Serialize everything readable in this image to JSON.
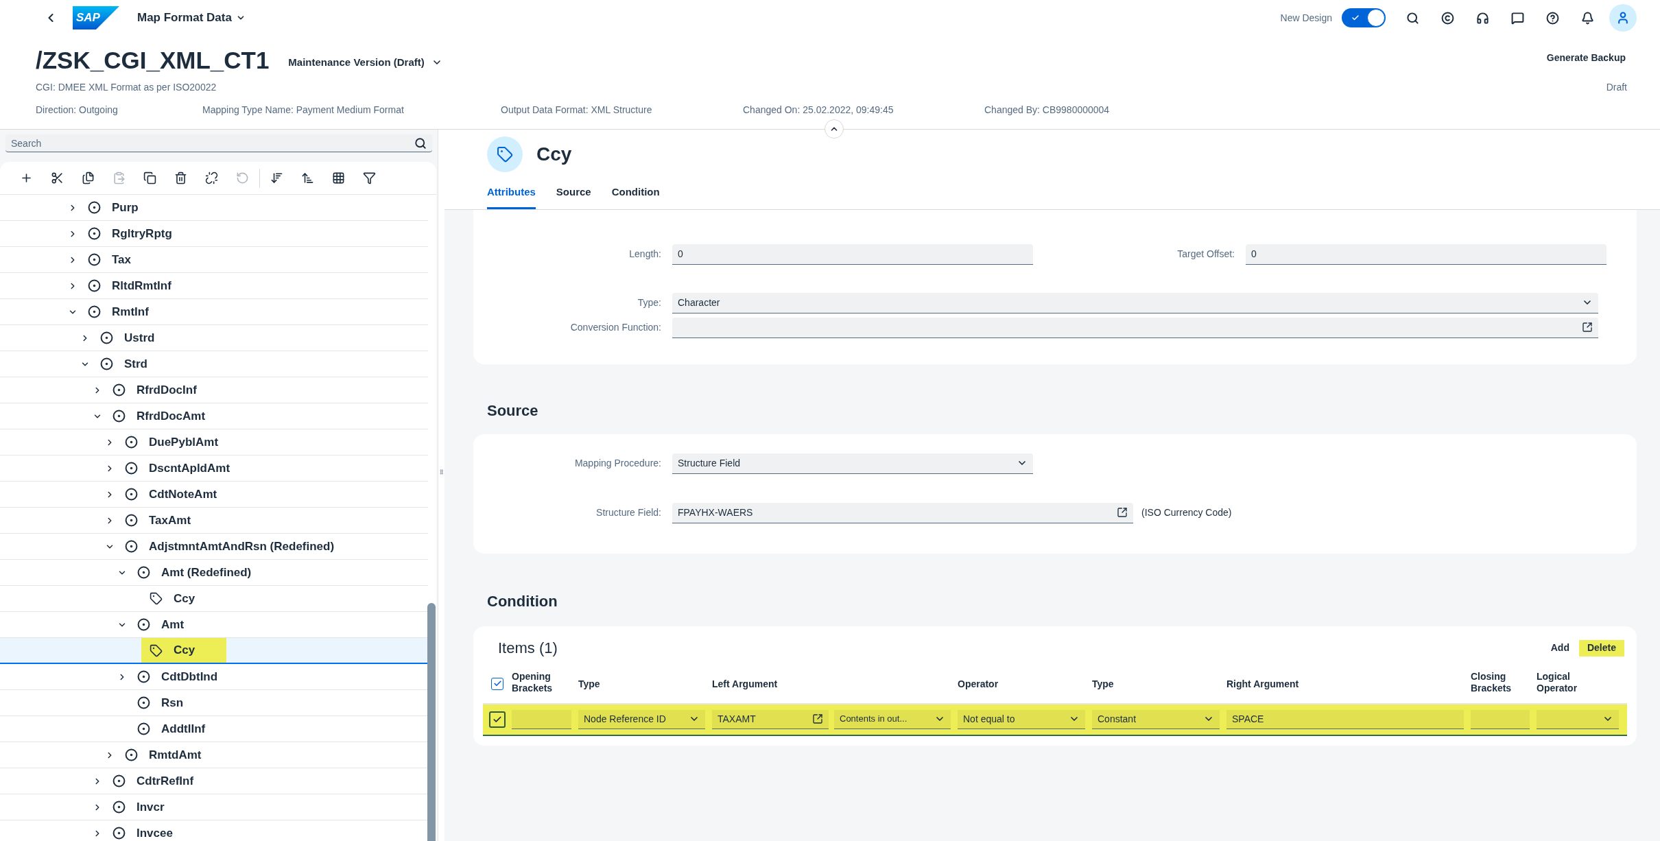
{
  "shell": {
    "logo": "SAP",
    "app_title": "Map Format Data",
    "new_design": {
      "label": "New Design",
      "on": true
    }
  },
  "header": {
    "title": "/ZSK_CGI_XML_CT1",
    "version": "Maintenance Version (Draft)",
    "subtitle": "CGI: DMEE XML Format as per ISO20022",
    "action": "Generate Backup",
    "status": "Draft",
    "attributes": [
      "Direction: Outgoing",
      "Mapping Type Name: Payment Medium Format",
      "Output Data Format: XML Structure",
      "Changed On: 25.02.2022, 09:49:45",
      "Changed By: CB9980000004"
    ]
  },
  "tree": {
    "search": {
      "placeholder": "Search"
    },
    "toolbar": [
      {
        "disabled": false
      },
      {
        "disabled": false
      },
      {
        "disabled": false
      },
      {
        "disabled": true
      },
      {
        "disabled": false
      },
      {
        "disabled": false
      },
      {
        "disabled": false
      },
      {
        "disabled": true
      },
      {
        "disabled": false
      },
      {
        "disabled": false
      },
      {
        "disabled": false
      },
      {
        "disabled": false
      }
    ],
    "nodes": [
      {
        "label": "Purp",
        "kind": "element",
        "expandable": true,
        "expanded": false,
        "selected": false,
        "highlighted": false
      },
      {
        "label": "RgltryRptg",
        "kind": "element",
        "expandable": true,
        "expanded": false,
        "selected": false,
        "highlighted": false
      },
      {
        "label": "Tax",
        "kind": "element",
        "expandable": true,
        "expanded": false,
        "selected": false,
        "highlighted": false
      },
      {
        "label": "RltdRmtInf",
        "kind": "element",
        "expandable": true,
        "expanded": false,
        "selected": false,
        "highlighted": false
      },
      {
        "label": "RmtInf",
        "kind": "element",
        "expandable": true,
        "expanded": true,
        "selected": false,
        "highlighted": false,
        "children": [
          {
            "label": "Ustrd",
            "kind": "element",
            "expandable": true,
            "expanded": false,
            "selected": false,
            "highlighted": false
          },
          {
            "label": "Strd",
            "kind": "element",
            "expandable": true,
            "expanded": true,
            "selected": false,
            "highlighted": false,
            "children": [
              {
                "label": "RfrdDocInf",
                "kind": "element",
                "expandable": true,
                "expanded": false,
                "selected": false,
                "highlighted": false
              },
              {
                "label": "RfrdDocAmt",
                "kind": "element",
                "expandable": true,
                "expanded": true,
                "selected": false,
                "highlighted": false,
                "children": [
                  {
                    "label": "DuePyblAmt",
                    "kind": "element",
                    "expandable": true,
                    "expanded": false,
                    "selected": false,
                    "highlighted": false
                  },
                  {
                    "label": "DscntApldAmt",
                    "kind": "element",
                    "expandable": true,
                    "expanded": false,
                    "selected": false,
                    "highlighted": false
                  },
                  {
                    "label": "CdtNoteAmt",
                    "kind": "element",
                    "expandable": true,
                    "expanded": false,
                    "selected": false,
                    "highlighted": false
                  },
                  {
                    "label": "TaxAmt",
                    "kind": "element",
                    "expandable": true,
                    "expanded": false,
                    "selected": false,
                    "highlighted": false
                  },
                  {
                    "label": "AdjstmntAmtAndRsn (Redefined)",
                    "kind": "element",
                    "expandable": true,
                    "expanded": true,
                    "selected": false,
                    "highlighted": false,
                    "children": [
                      {
                        "label": "Amt (Redefined)",
                        "kind": "element",
                        "expandable": true,
                        "expanded": true,
                        "selected": false,
                        "highlighted": false,
                        "children": [
                          {
                            "label": "Ccy",
                            "kind": "attribute",
                            "expandable": false,
                            "selected": false,
                            "highlighted": false
                          }
                        ]
                      },
                      {
                        "label": "Amt",
                        "kind": "element",
                        "expandable": true,
                        "expanded": true,
                        "selected": false,
                        "highlighted": false,
                        "children": [
                          {
                            "label": "Ccy",
                            "kind": "attribute",
                            "expandable": false,
                            "selected": true,
                            "highlighted": true
                          }
                        ]
                      },
                      {
                        "label": "CdtDbtInd",
                        "kind": "element",
                        "expandable": true,
                        "expanded": false,
                        "selected": false,
                        "highlighted": false
                      },
                      {
                        "label": "Rsn",
                        "kind": "element",
                        "expandable": false,
                        "selected": false,
                        "highlighted": false
                      },
                      {
                        "label": "AddtlInf",
                        "kind": "element",
                        "expandable": false,
                        "selected": false,
                        "highlighted": false
                      }
                    ]
                  },
                  {
                    "label": "RmtdAmt",
                    "kind": "element",
                    "expandable": true,
                    "expanded": false,
                    "selected": false,
                    "highlighted": false
                  }
                ]
              },
              {
                "label": "CdtrRefInf",
                "kind": "element",
                "expandable": true,
                "expanded": false,
                "selected": false,
                "highlighted": false
              },
              {
                "label": "Invcr",
                "kind": "element",
                "expandable": true,
                "expanded": false,
                "selected": false,
                "highlighted": false
              },
              {
                "label": "Invcee",
                "kind": "element",
                "expandable": true,
                "expanded": false,
                "selected": false,
                "highlighted": false
              }
            ]
          }
        ]
      }
    ]
  },
  "detail": {
    "title": "Ccy",
    "tabs": [
      {
        "label": "Attributes",
        "selected": true
      },
      {
        "label": "Source",
        "selected": false
      },
      {
        "label": "Condition",
        "selected": false
      }
    ],
    "attributes": {
      "rows": [
        [
          {
            "label": "Length:",
            "value": "0",
            "kind": "input"
          },
          {
            "label": "Target Offset:",
            "value": "0",
            "kind": "input"
          }
        ],
        [
          {
            "label": "Type:",
            "value": "Character",
            "kind": "select"
          }
        ],
        [
          {
            "label": "Conversion Function:",
            "kind": "valuehelp"
          }
        ]
      ]
    },
    "source": {
      "title": "Source",
      "fields": [
        {
          "label": "Mapping Procedure:",
          "value": "Structure Field",
          "kind": "select"
        },
        {
          "label": "Structure Field:",
          "value": "FPAYHX-WAERS",
          "kind": "valuehelp",
          "description": "(ISO Currency Code)"
        }
      ]
    },
    "condition": {
      "title": "Condition",
      "table_title": "Items (1)",
      "actions": [
        {
          "label": "Add",
          "highlighted": false
        },
        {
          "label": "Delete",
          "highlighted": true
        }
      ],
      "select_all": {
        "checked": true
      },
      "columns": [
        "Opening Brackets",
        "Type",
        "Left Argument",
        "Operator",
        "Type",
        "Right Argument",
        "Closing Brackets",
        "Logical Operator"
      ],
      "rows": [
        {
          "checked": true,
          "highlighted": true,
          "cells": [
            {
              "kind": "input"
            },
            {
              "kind": "select",
              "value": "Node Reference ID"
            },
            {
              "kind": "valuehelp_select",
              "value": "TAXAMT",
              "qualifier": "Contents in out..."
            },
            {
              "kind": "select",
              "value": "Not equal to"
            },
            {
              "kind": "select",
              "value": "Constant"
            },
            {
              "kind": "input",
              "value": "SPACE"
            },
            {
              "kind": "input"
            },
            {
              "kind": "select"
            }
          ]
        }
      ]
    }
  }
}
